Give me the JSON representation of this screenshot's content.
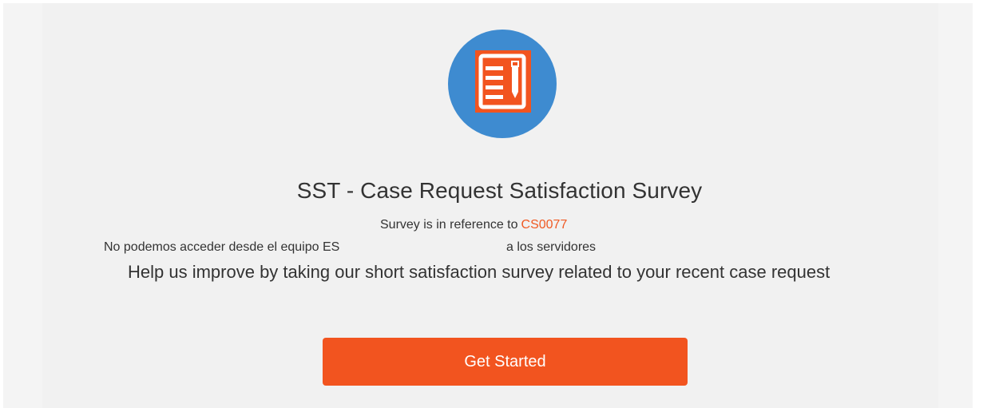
{
  "survey": {
    "title": "SST - Case Request Satisfaction Survey",
    "reference_prefix": "Survey is in reference to",
    "case_number": "CS0077",
    "case_description_part1": "No podemos acceder desde el equipo ES",
    "case_description_part2": "a los servidores",
    "help_text": "Help us improve by taking our short satisfaction survey related to your recent case request",
    "start_button_label": "Get Started"
  },
  "icons": {
    "logo": "survey-form-icon"
  },
  "colors": {
    "accent": "#f2541f",
    "logo_circle": "#3e8bd0",
    "case_link": "#f05a24",
    "text": "#333333",
    "background": "#f1f1f1"
  }
}
